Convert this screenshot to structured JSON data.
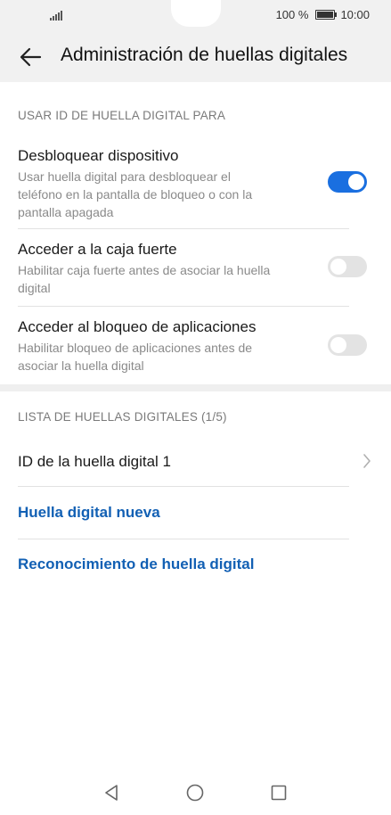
{
  "status": {
    "battery_pct": "100 %",
    "time": "10:00"
  },
  "appbar": {
    "back_icon": "arrow-left-icon",
    "title": "Administración de huellas digitales"
  },
  "section_use": {
    "header": "USAR ID DE HUELLA DIGITAL PARA",
    "items": [
      {
        "title": "Desbloquear dispositivo",
        "subtitle_lines": [
          "Usar huella digital para desbloquear el",
          "teléfono en la pantalla de bloqueo o con la",
          "pantalla apagada"
        ],
        "enabled": true
      },
      {
        "title": "Acceder a la caja fuerte",
        "subtitle_lines": [
          "Habilitar caja fuerte antes de asociar la huella",
          "digital"
        ],
        "enabled": false
      },
      {
        "title": "Acceder al bloqueo de aplicaciones",
        "subtitle_lines": [
          "Habilitar bloqueo de aplicaciones antes de",
          "asociar la huella digital"
        ],
        "enabled": false
      }
    ]
  },
  "section_list": {
    "header": "LISTA DE HUELLAS DIGITALES (1/5)",
    "fingerprint_item": "ID de la huella digital 1",
    "new_fingerprint": "Huella digital nueva",
    "recognition": "Reconocimiento de huella digital"
  },
  "colors": {
    "accent": "#1a6fe0",
    "link": "#1260b4",
    "toggle_off": "#e3e3e3"
  },
  "navbar": {
    "icons": [
      "back-triangle-icon",
      "home-circle-icon",
      "recents-square-icon"
    ]
  }
}
